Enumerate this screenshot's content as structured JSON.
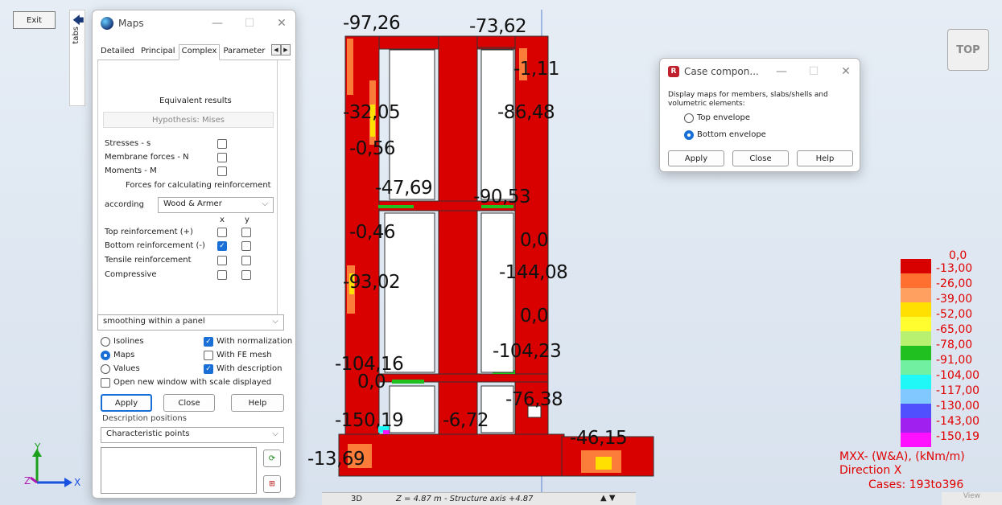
{
  "toolbar": {
    "exit_label": "Exit",
    "tabs_label": "tabs"
  },
  "maps_dialog": {
    "title": "Maps",
    "tabs": [
      "Detailed",
      "Principal",
      "Complex",
      "Parameter"
    ],
    "section_title": "Equivalent results",
    "hypothesis": "Hypothesis: Mises",
    "stresses": "Stresses - s",
    "membrane": "Membrane forces - N",
    "moments": "Moments - M",
    "forces_title": "Forces for calculating reinforcement",
    "according_label": "according",
    "according_value": "Wood & Armer",
    "col_x": "x",
    "col_y": "y",
    "rows": [
      "Top reinforcement (+)",
      "Bottom reinforcement (-)",
      "Tensile reinforcement",
      "Compressive"
    ],
    "smoothing": "smoothing within a panel",
    "isolines": "Isolines",
    "maps": "Maps",
    "values": "Values",
    "with_normalization": "With normalization",
    "with_fe_mesh": "With FE mesh",
    "with_description": "With description",
    "open_new_window": "Open new window with scale displayed",
    "apply": "Apply",
    "close": "Close",
    "help": "Help",
    "desc_positions_label": "Description positions",
    "desc_positions_value": "Characteristic points"
  },
  "case_dialog": {
    "title": "Case compon...",
    "description": "Display maps for members, slabs/shells and volumetric elements:",
    "top_envelope": "Top envelope",
    "bottom_envelope": "Bottom envelope",
    "apply": "Apply",
    "close": "Close",
    "help": "Help"
  },
  "view": {
    "top_cube": "TOP",
    "status": "Z = 4.87 m - Structure axis +4.87",
    "view_tab": "3D",
    "view_btn": "View",
    "axis_y": "Y",
    "axis_x": "X",
    "axis_z": "Z"
  },
  "annotations": [
    "-97,26",
    "-73,62",
    "-1,11",
    "-32,05",
    "-86,48",
    "-0,56",
    "-47,69",
    "-90,53",
    "-0,46",
    "0,0",
    "-144,08",
    "-93,02",
    "0,0",
    "-104,16",
    "-104,23",
    "0,0",
    "-76,38",
    "-150,19",
    "-6,72",
    "-46,15",
    "-13,69"
  ],
  "legend": {
    "entries": [
      {
        "label": "0,0",
        "color": "#d90000"
      },
      {
        "label": "-13,00",
        "color": "#ff7030"
      },
      {
        "label": "-26,00",
        "color": "#ffa060"
      },
      {
        "label": "-39,00",
        "color": "#ffe000"
      },
      {
        "label": "-52,00",
        "color": "#fffc30"
      },
      {
        "label": "-65,00",
        "color": "#b8f070"
      },
      {
        "label": "-78,00",
        "color": "#20c020"
      },
      {
        "label": "-91,00",
        "color": "#70f0a0"
      },
      {
        "label": "-104,00",
        "color": "#20f8f8"
      },
      {
        "label": "-117,00",
        "color": "#80c8ff"
      },
      {
        "label": "-130,00",
        "color": "#5050ff"
      },
      {
        "label": "-143,00",
        "color": "#a020f0"
      },
      {
        "label": "-150,19",
        "color": "#ff10ff"
      }
    ],
    "title1": "MXX- (W&A), (kNm/m)",
    "title2": "Direction X",
    "title3": "Cases: 193to396"
  }
}
